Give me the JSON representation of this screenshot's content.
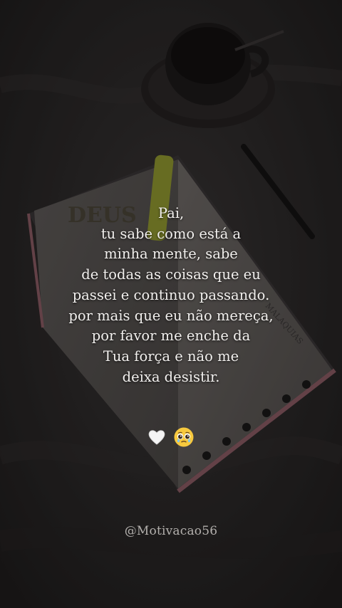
{
  "quote": {
    "lines": [
      "Pai,",
      "tu sabe como está a",
      "minha mente, sabe",
      "de todas as coisas que eu",
      "passei e continuo passando.",
      "por mais que eu não mereça,",
      "por favor me enche da",
      "Tua força e não me",
      "deixa desistir."
    ]
  },
  "emojis": {
    "heart": "white-heart-icon",
    "face": "pleading-face-icon"
  },
  "background": {
    "book_cover_text": "DEUS",
    "book_page_text": "MALAQUIAS",
    "colors": {
      "background": "#2a2727",
      "cup": "#1c1a1a",
      "bible_pages": "#6b6663",
      "highlighter": "#b8c23a",
      "book_edge": "#8a5a63"
    }
  },
  "footer": {
    "handle": "@Motivacao56"
  }
}
